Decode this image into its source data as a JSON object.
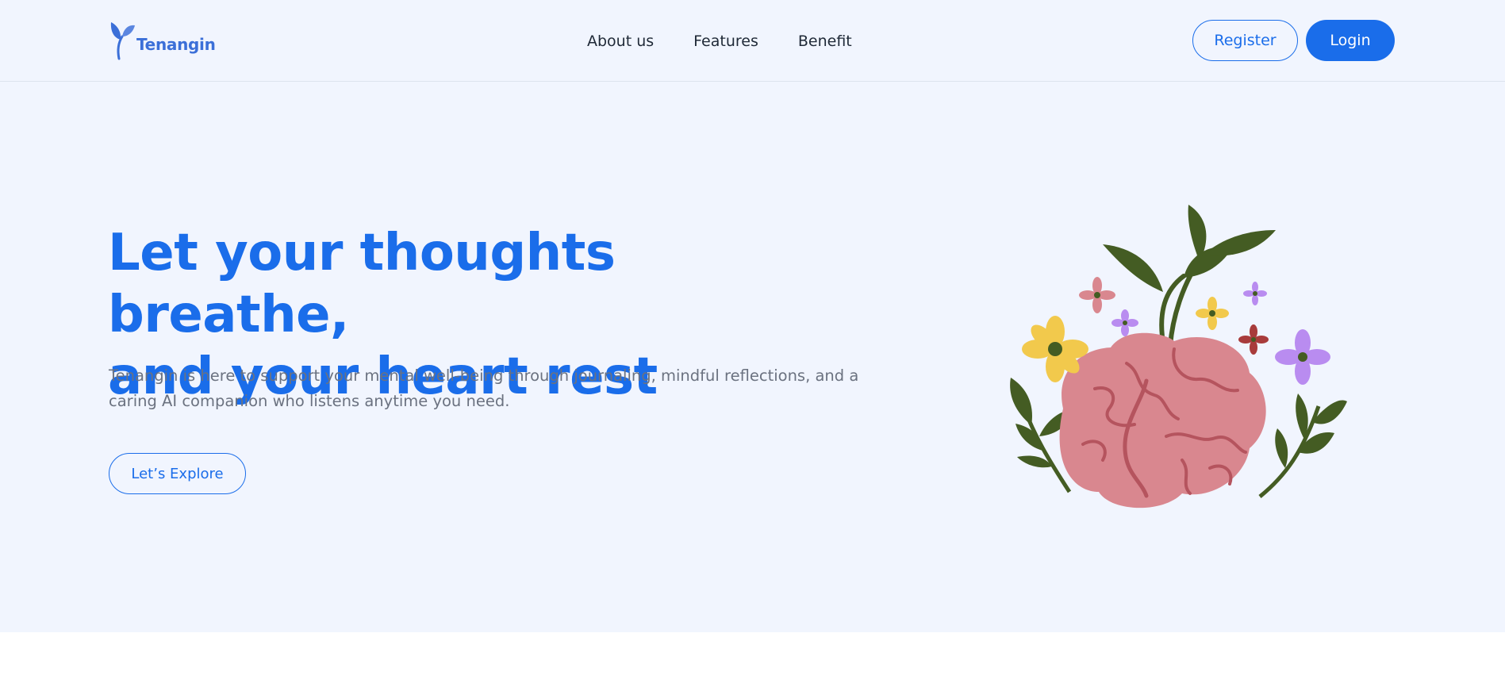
{
  "brand": {
    "name": "Tenangin",
    "logo_icon": "sprout-icon",
    "color": "#1a6dea"
  },
  "nav": {
    "items": [
      {
        "label": "About us"
      },
      {
        "label": "Features"
      },
      {
        "label": "Benefit"
      }
    ]
  },
  "auth": {
    "register_label": "Register",
    "login_label": "Login"
  },
  "hero": {
    "title_line1": "Let your thoughts breathe,",
    "title_line2": "and your heart rest",
    "description": "Tenangin is here to support your mental well-being through journaling, mindful reflections, and a caring AI companion who listens anytime you need.",
    "cta_label": "Let’s Explore",
    "illustration": "brain-with-flowers-illustration"
  },
  "colors": {
    "primary": "#1a6dea",
    "background": "#f1f5fe",
    "text_muted": "#6b7280",
    "brain_pink": "#d9878f",
    "leaf_green": "#445c23"
  }
}
